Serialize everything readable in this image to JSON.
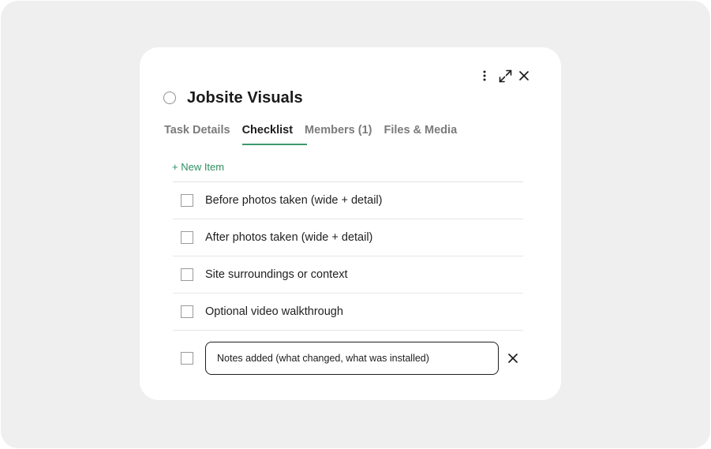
{
  "task": {
    "title": "Jobsite Visuals"
  },
  "tabs": [
    {
      "label": "Task Details"
    },
    {
      "label": "Checklist"
    },
    {
      "label": "Members (1)"
    },
    {
      "label": "Files & Media"
    }
  ],
  "checklist": {
    "new_item_label": "+ New Item",
    "items": [
      {
        "label": "Before photos taken (wide + detail)",
        "checked": false
      },
      {
        "label": "After photos taken (wide + detail)",
        "checked": false
      },
      {
        "label": "Site surroundings or context",
        "checked": false
      },
      {
        "label": "Optional video walkthrough",
        "checked": false
      }
    ],
    "editing_item_value": "Notes added (what changed, what was installed)"
  },
  "icons": {
    "more": "vertical-dots-icon",
    "expand": "expand-icon",
    "close": "close-icon",
    "clear": "close-icon"
  },
  "colors": {
    "accent": "#3c9a6b",
    "new_item": "#2f8f62",
    "backdrop": "#efefef"
  }
}
